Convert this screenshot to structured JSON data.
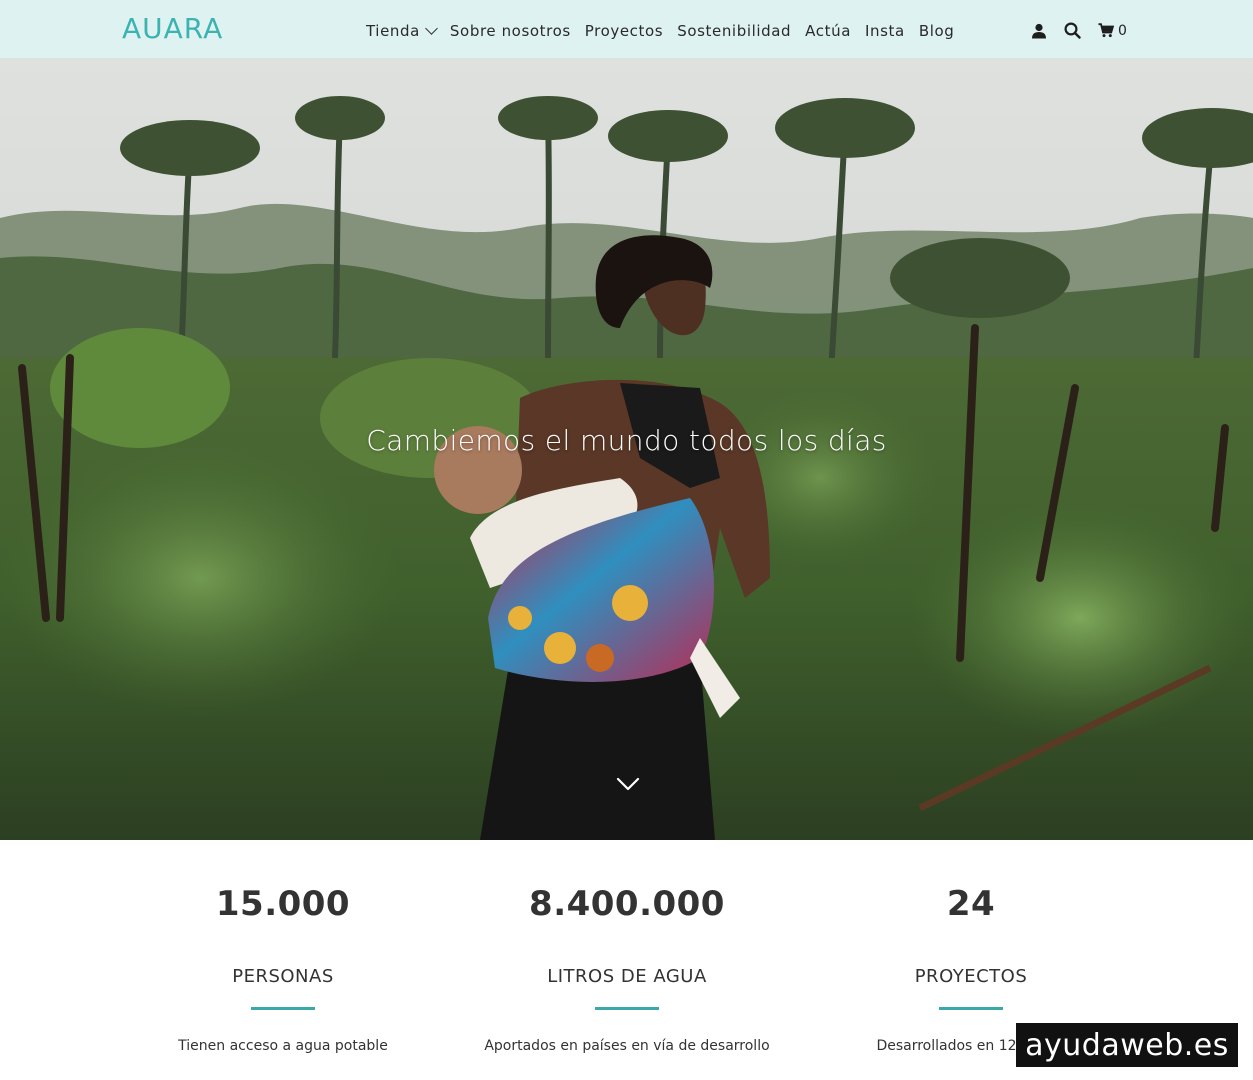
{
  "header": {
    "logo": "AUARA",
    "nav": [
      {
        "label": "Tienda",
        "has_dropdown": true
      },
      {
        "label": "Sobre nosotros"
      },
      {
        "label": "Proyectos"
      },
      {
        "label": "Sostenibilidad"
      },
      {
        "label": "Actúa"
      },
      {
        "label": "Insta"
      },
      {
        "label": "Blog"
      }
    ],
    "icons": [
      "user-icon",
      "search-icon",
      "cart-icon"
    ],
    "cart_count": "0",
    "background": "#dff2f2",
    "brand_color": "#3bb3b0"
  },
  "hero": {
    "title": "Cambiemos el mundo todos los días",
    "scroll_icon": "chevron-down-icon"
  },
  "stats": [
    {
      "number": "15.000",
      "label": "PERSONAS",
      "description": "Tienen acceso a agua potable"
    },
    {
      "number": "8.400.000",
      "label": "LITROS DE AGUA",
      "description": "Aportados en países en vía de desarrollo"
    },
    {
      "number": "24",
      "label": "PROYECTOS",
      "description": "Desarrollados en 12 países"
    }
  ],
  "accent_color": "#3ba9a7",
  "watermark": "ayudaweb.es"
}
